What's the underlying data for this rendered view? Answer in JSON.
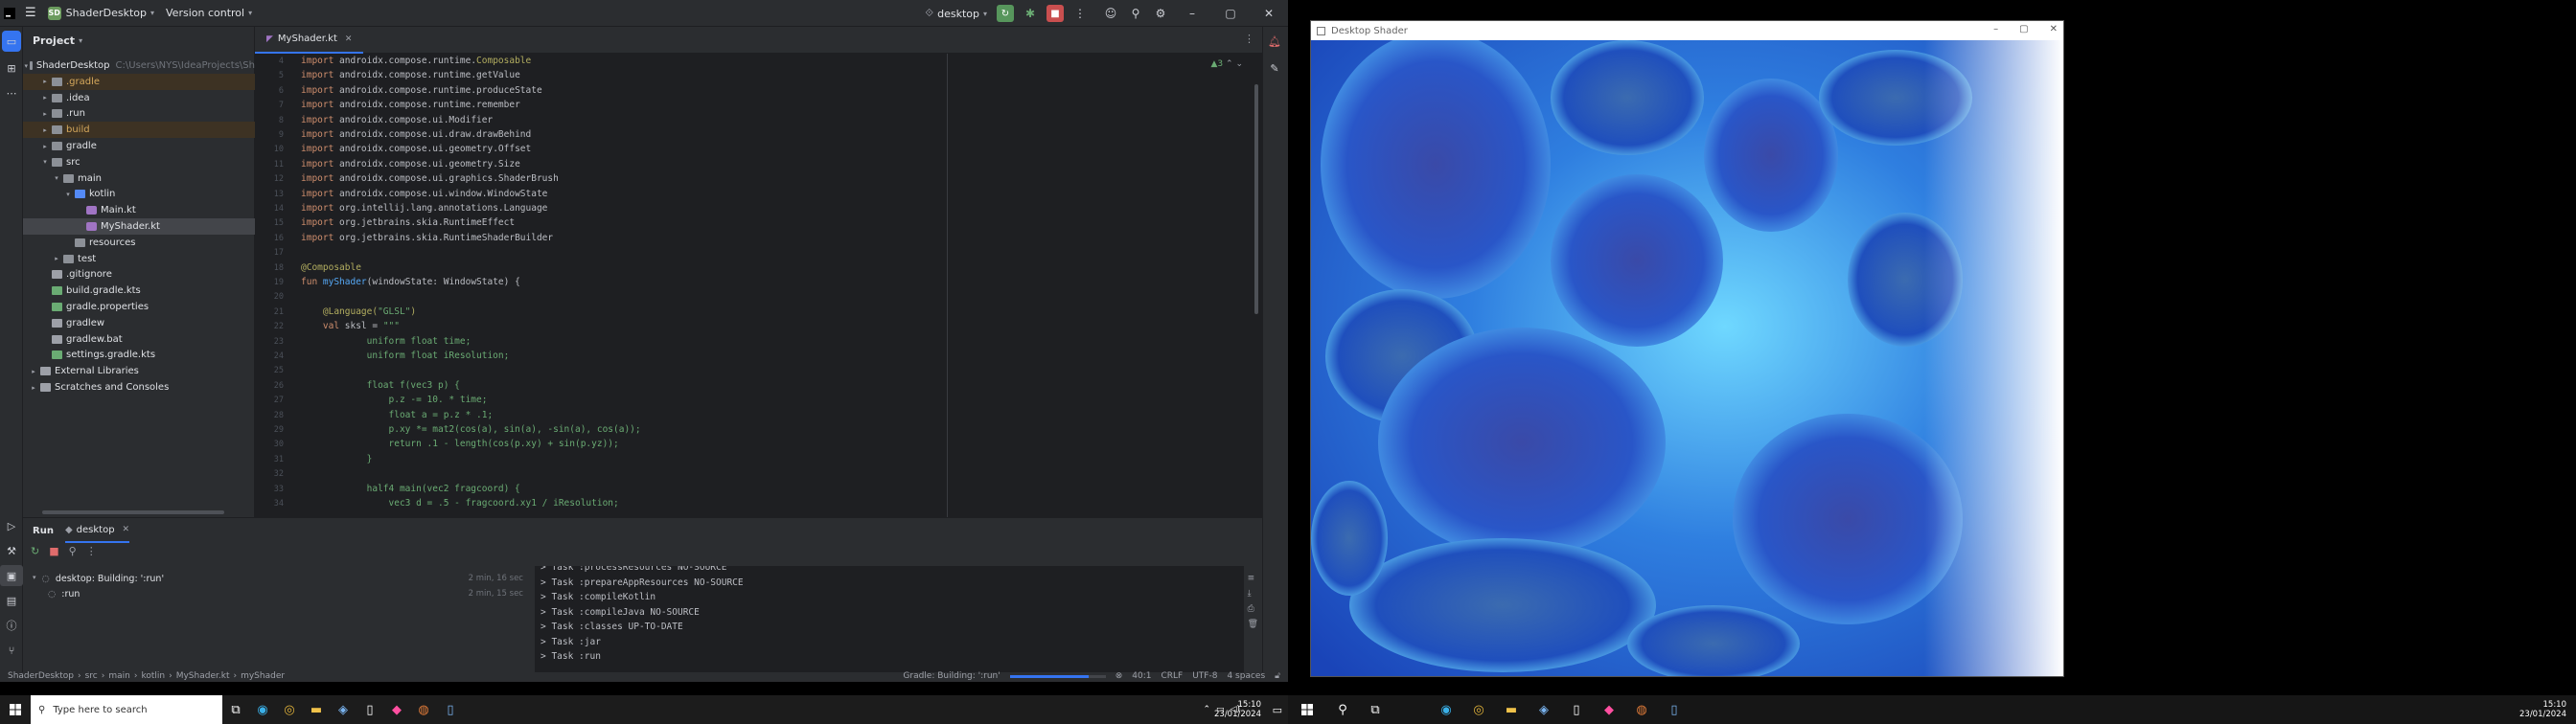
{
  "ide": {
    "project_name": "ShaderDesktop",
    "project_badge": "SD",
    "vcs": "Version control",
    "run_config": "desktop"
  },
  "project_panel": {
    "title": "Project",
    "tree": [
      {
        "label": "ShaderDesktop",
        "hint": "C:\\Users\\NYS\\IdeaProjects\\Sh",
        "arrow": "down",
        "icon": "folder",
        "depth": 0,
        "color": "#dfe1e5"
      },
      {
        "label": ".gradle",
        "arrow": "right",
        "icon": "folder",
        "depth": 1,
        "color": "#d5a85c",
        "highlight": "orange"
      },
      {
        "label": ".idea",
        "arrow": "right",
        "icon": "folder",
        "depth": 1,
        "color": "#dfe1e5"
      },
      {
        "label": ".run",
        "arrow": "right",
        "icon": "folder",
        "depth": 1,
        "color": "#dfe1e5"
      },
      {
        "label": "build",
        "arrow": "right",
        "icon": "folder",
        "depth": 1,
        "color": "#d5a85c",
        "highlight": "orange"
      },
      {
        "label": "gradle",
        "arrow": "right",
        "icon": "folder",
        "depth": 1,
        "color": "#dfe1e5"
      },
      {
        "label": "src",
        "arrow": "down",
        "icon": "folder",
        "depth": 1,
        "color": "#dfe1e5"
      },
      {
        "label": "main",
        "arrow": "down",
        "icon": "folder",
        "depth": 2,
        "color": "#dfe1e5"
      },
      {
        "label": "kotlin",
        "arrow": "down",
        "icon": "folder-blue",
        "depth": 3,
        "color": "#dfe1e5"
      },
      {
        "label": "Main.kt",
        "arrow": "",
        "icon": "kotlin",
        "depth": 4,
        "color": "#dfe1e5"
      },
      {
        "label": "MyShader.kt",
        "arrow": "",
        "icon": "kotlin",
        "depth": 4,
        "color": "#dfe1e5",
        "highlight": "selected"
      },
      {
        "label": "resources",
        "arrow": "",
        "icon": "folder",
        "depth": 3,
        "color": "#dfe1e5"
      },
      {
        "label": "test",
        "arrow": "right",
        "icon": "folder",
        "depth": 2,
        "color": "#dfe1e5"
      },
      {
        "label": ".gitignore",
        "arrow": "",
        "icon": "file",
        "depth": 1,
        "color": "#dfe1e5"
      },
      {
        "label": "build.gradle.kts",
        "arrow": "",
        "icon": "gradle",
        "depth": 1,
        "color": "#dfe1e5"
      },
      {
        "label": "gradle.properties",
        "arrow": "",
        "icon": "gradle",
        "depth": 1,
        "color": "#dfe1e5"
      },
      {
        "label": "gradlew",
        "arrow": "",
        "icon": "file",
        "depth": 1,
        "color": "#dfe1e5"
      },
      {
        "label": "gradlew.bat",
        "arrow": "",
        "icon": "file",
        "depth": 1,
        "color": "#dfe1e5"
      },
      {
        "label": "settings.gradle.kts",
        "arrow": "",
        "icon": "gradle",
        "depth": 1,
        "color": "#dfe1e5"
      },
      {
        "label": "External Libraries",
        "arrow": "right",
        "icon": "library",
        "depth": 0,
        "color": "#dfe1e5"
      },
      {
        "label": "Scratches and Consoles",
        "arrow": "right",
        "icon": "scratch",
        "depth": 0,
        "color": "#dfe1e5"
      }
    ]
  },
  "editor": {
    "tab": "MyShader.kt",
    "indicator": "▲3",
    "line_numbers": [
      "4",
      "5",
      "6",
      "7",
      "8",
      "9",
      "10",
      "11",
      "12",
      "13",
      "14",
      "15",
      "16",
      "17",
      "18",
      "19",
      "20",
      "21",
      "22",
      "23",
      "24",
      "25",
      "26",
      "27",
      "28",
      "29",
      "30",
      "31",
      "32",
      "33",
      "34"
    ],
    "lines": [
      [
        {
          "t": "import ",
          "c": "kw"
        },
        {
          "t": "androidx.compose.runtime.",
          "c": ""
        },
        {
          "t": "Composable",
          "c": "an"
        }
      ],
      [
        {
          "t": "import ",
          "c": "kw"
        },
        {
          "t": "androidx.compose.runtime.getValue",
          "c": ""
        }
      ],
      [
        {
          "t": "import ",
          "c": "kw"
        },
        {
          "t": "androidx.compose.runtime.produceState",
          "c": ""
        }
      ],
      [
        {
          "t": "import ",
          "c": "kw"
        },
        {
          "t": "androidx.compose.runtime.remember",
          "c": ""
        }
      ],
      [
        {
          "t": "import ",
          "c": "kw"
        },
        {
          "t": "androidx.compose.ui.Modifier",
          "c": ""
        }
      ],
      [
        {
          "t": "import ",
          "c": "kw"
        },
        {
          "t": "androidx.compose.ui.draw.drawBehind",
          "c": ""
        }
      ],
      [
        {
          "t": "import ",
          "c": "kw"
        },
        {
          "t": "androidx.compose.ui.geometry.Offset",
          "c": ""
        }
      ],
      [
        {
          "t": "import ",
          "c": "kw"
        },
        {
          "t": "androidx.compose.ui.geometry.Size",
          "c": ""
        }
      ],
      [
        {
          "t": "import ",
          "c": "kw"
        },
        {
          "t": "androidx.compose.ui.graphics.ShaderBrush",
          "c": ""
        }
      ],
      [
        {
          "t": "import ",
          "c": "kw"
        },
        {
          "t": "androidx.compose.ui.window.WindowState",
          "c": ""
        }
      ],
      [
        {
          "t": "import ",
          "c": "kw"
        },
        {
          "t": "org.intellij.lang.annotations.Language",
          "c": ""
        }
      ],
      [
        {
          "t": "import ",
          "c": "kw"
        },
        {
          "t": "org.jetbrains.skia.RuntimeEffect",
          "c": ""
        }
      ],
      [
        {
          "t": "import ",
          "c": "kw"
        },
        {
          "t": "org.jetbrains.skia.RuntimeShaderBuilder",
          "c": ""
        }
      ],
      [],
      [
        {
          "t": "@Composable",
          "c": "an"
        }
      ],
      [
        {
          "t": "fun ",
          "c": "kw"
        },
        {
          "t": "myShader",
          "c": "fn"
        },
        {
          "t": "(windowState: WindowState) {",
          "c": ""
        }
      ],
      [],
      [
        {
          "t": "    @Language(",
          "c": "an"
        },
        {
          "t": "\"GLSL\"",
          "c": "str"
        },
        {
          "t": ")",
          "c": "an"
        }
      ],
      [
        {
          "t": "    val ",
          "c": "kw"
        },
        {
          "t": "sksl = ",
          "c": ""
        },
        {
          "t": "\"\"\"",
          "c": "str"
        }
      ],
      [
        {
          "t": "            uniform float time;",
          "c": "sh"
        }
      ],
      [
        {
          "t": "            uniform float iResolution;",
          "c": "sh"
        }
      ],
      [],
      [
        {
          "t": "            float f(vec3 p) {",
          "c": "sh"
        }
      ],
      [
        {
          "t": "                p.z -= 10. * time;",
          "c": "sh"
        }
      ],
      [
        {
          "t": "                float a = p.z * .1;",
          "c": "sh"
        }
      ],
      [
        {
          "t": "                p.xy *= mat2(cos(a), sin(a), -sin(a), cos(a));",
          "c": "sh"
        }
      ],
      [
        {
          "t": "                return .1 - length(cos(p.xy) + sin(p.yz));",
          "c": "sh"
        }
      ],
      [
        {
          "t": "            }",
          "c": "sh"
        }
      ],
      [],
      [
        {
          "t": "            half4 main(vec2 fragcoord) {",
          "c": "sh"
        }
      ],
      [
        {
          "t": "                vec3 d = .5 - fragcoord.xy1 / iResolution;",
          "c": "sh"
        }
      ]
    ]
  },
  "run_panel": {
    "tab_run": "Run",
    "tab_config": "desktop",
    "tree_root": "desktop: Building: ':run'",
    "tree_root_time": "2 min, 16 sec",
    "tree_child": ":run",
    "tree_child_time": "2 min, 15 sec",
    "console": [
      "> Task :processResources NO-SOURCE",
      "> Task :prepareAppResources NO-SOURCE",
      "> Task :compileKotlin",
      "> Task :compileJava NO-SOURCE",
      "> Task :classes UP-TO-DATE",
      "> Task :jar",
      "> Task :run"
    ]
  },
  "statusbar": {
    "breadcrumb": [
      "ShaderDesktop",
      "src",
      "main",
      "kotlin",
      "MyShader.kt",
      "myShader"
    ],
    "gradle_status": "Gradle: Building: ':run'",
    "progress": 0.82,
    "position": "40:1",
    "line_sep": "CRLF",
    "encoding": "UTF-8",
    "indent": "4 spaces"
  },
  "shader_window": {
    "title": "Desktop Shader"
  },
  "taskbar_left": {
    "search_placeholder": "Type here to search",
    "time": "15:10",
    "date": "23/01/2024"
  },
  "taskbar_right": {
    "time": "15:10",
    "date": "23/01/2024"
  }
}
